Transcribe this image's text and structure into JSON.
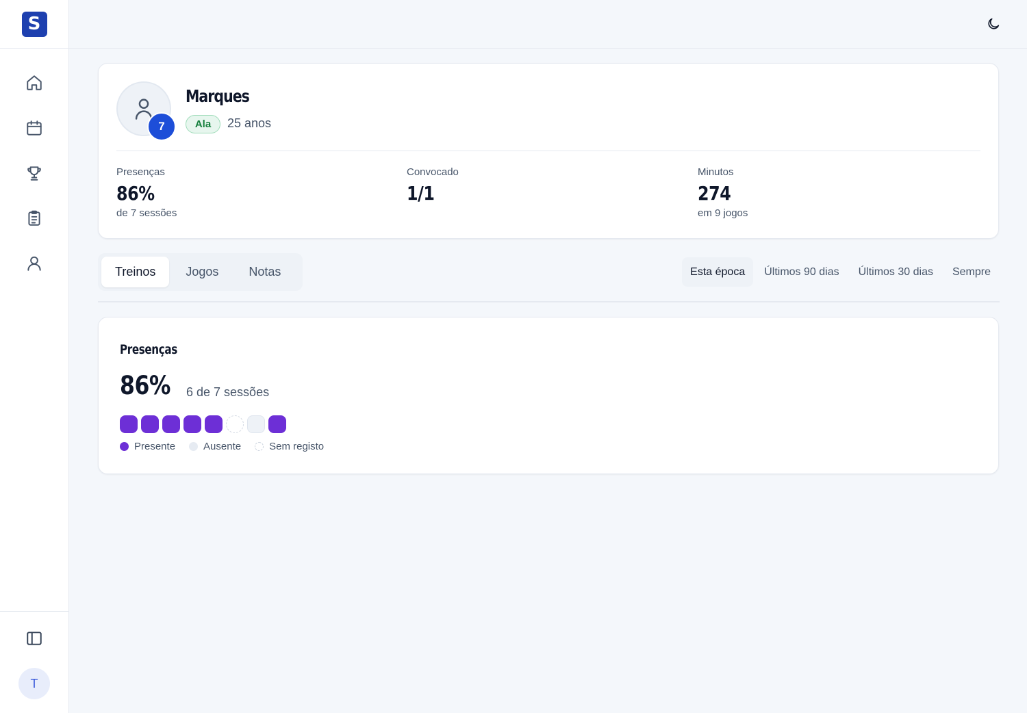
{
  "app": {
    "logo_letter": "S"
  },
  "sidebar": {
    "items": [
      {
        "name": "home",
        "icon": "home-icon"
      },
      {
        "name": "calendar",
        "icon": "calendar-icon"
      },
      {
        "name": "trophy",
        "icon": "trophy-icon"
      },
      {
        "name": "clipboard",
        "icon": "clipboard-list-icon"
      },
      {
        "name": "user",
        "icon": "user-icon"
      }
    ],
    "collapse_icon": "sidebar-panel-icon",
    "user_initial": "T"
  },
  "topbar": {
    "theme_icon": "moon-icon"
  },
  "profile": {
    "name": "Marques",
    "jersey_number": "7",
    "position": "Ala",
    "age": "25 anos",
    "stats": [
      {
        "label": "Presenças",
        "value": "86%",
        "sub": "de 7 sessões"
      },
      {
        "label": "Convocado",
        "value": "1/1",
        "sub": ""
      },
      {
        "label": "Minutos",
        "value": "274",
        "sub": "em 9 jogos"
      }
    ]
  },
  "tabs": [
    {
      "label": "Treinos",
      "active": true
    },
    {
      "label": "Jogos",
      "active": false
    },
    {
      "label": "Notas",
      "active": false
    }
  ],
  "periods": [
    {
      "label": "Esta época",
      "active": true
    },
    {
      "label": "Últimos 90 dias",
      "active": false
    },
    {
      "label": "Últimos 30 dias",
      "active": false
    },
    {
      "label": "Sempre",
      "active": false
    }
  ],
  "attendance": {
    "title": "Presenças",
    "percent": "86%",
    "sessions_text": "6 de 7 sessões",
    "sessions": [
      "present",
      "present",
      "present",
      "present",
      "present",
      "norecord",
      "absent",
      "present"
    ],
    "legend": {
      "present": "Presente",
      "absent": "Ausente",
      "norecord": "Sem registo"
    }
  },
  "colors": {
    "brand": "#1e40af",
    "jersey": "#1d4ed8",
    "present": "#6d2fd6",
    "badge_green": "#15803d"
  }
}
